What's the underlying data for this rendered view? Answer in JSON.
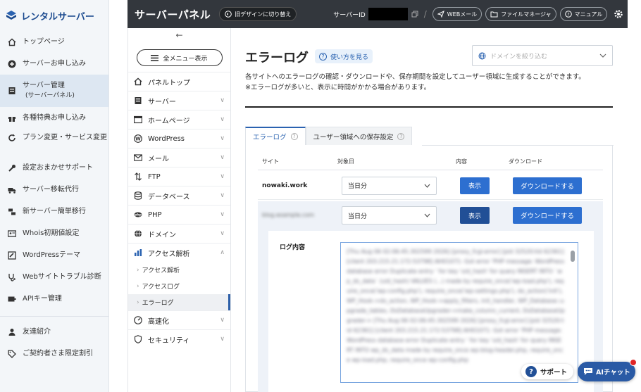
{
  "brand": {
    "name": "レンタルサーバー"
  },
  "account_menu": [
    {
      "label": "トップページ",
      "icon": "home-icon"
    },
    {
      "label": "サーバーお申し込み",
      "icon": "plus-circle-icon"
    },
    {
      "label": "サーバー管理",
      "sub": "(サーバーパネル)",
      "icon": "server-icon",
      "active": true
    },
    {
      "label": "各種特典お申し込み",
      "icon": "gift-icon"
    },
    {
      "label": "プラン変更・サービス変更",
      "icon": "refresh-icon"
    },
    {
      "label": "設定おまかせサポート",
      "icon": "wrench-icon"
    },
    {
      "label": "サーバー移転代行",
      "icon": "truck-icon"
    },
    {
      "label": "新サーバー簡単移行",
      "icon": "transfer-icon"
    },
    {
      "label": "Whois初期値設定",
      "icon": "id-card-icon"
    },
    {
      "label": "WordPressテーマ",
      "icon": "theme-icon"
    },
    {
      "label": "Webサイトトラブル診断",
      "icon": "stethoscope-icon"
    },
    {
      "label": "APIキー管理",
      "icon": "api-key-icon"
    },
    {
      "label": "友達紹介",
      "icon": "person-icon"
    },
    {
      "label": "ご契約者さま限定割引",
      "icon": "discount-icon"
    }
  ],
  "header": {
    "title": "サーバーパネル",
    "old_design": "旧デザインに切り替え",
    "server_id_label": "サーバーID",
    "webmail": "WEBメール",
    "file_manager": "ファイルマネージャ",
    "manual": "マニュアル"
  },
  "nav": {
    "all_menu": "全メニュー表示",
    "items": [
      {
        "label": "パネルトップ",
        "icon": "home-icon",
        "chevron": ""
      },
      {
        "label": "サーバー",
        "icon": "server-icon",
        "chevron": "∨"
      },
      {
        "label": "ホームページ",
        "icon": "browser-icon",
        "chevron": "∨"
      },
      {
        "label": "WordPress",
        "icon": "wordpress-icon",
        "chevron": "∨"
      },
      {
        "label": "メール",
        "icon": "mail-icon",
        "chevron": "∨"
      },
      {
        "label": "FTP",
        "icon": "ftp-icon",
        "chevron": "∨"
      },
      {
        "label": "データベース",
        "icon": "database-icon",
        "chevron": "∨"
      },
      {
        "label": "PHP",
        "icon": "php-icon",
        "chevron": "∨"
      },
      {
        "label": "ドメイン",
        "icon": "globe-icon",
        "chevron": "∨"
      },
      {
        "label": "アクセス解析",
        "icon": "bar-chart-icon",
        "chevron": "∧"
      }
    ],
    "sub_items": [
      {
        "label": "アクセス解析"
      },
      {
        "label": "アクセスログ"
      },
      {
        "label": "エラーログ",
        "active": true
      }
    ],
    "items_after": [
      {
        "label": "高速化",
        "icon": "rocket-icon",
        "chevron": "∨"
      },
      {
        "label": "セキュリティ",
        "icon": "shield-icon",
        "chevron": "∨"
      }
    ]
  },
  "main": {
    "title": "エラーログ",
    "help": "使い方を見る",
    "domain_placeholder": "ドメインを絞り込む",
    "desc1": "各サイトへのエラーログの確認・ダウンロードや、保存期間を設定してユーザー領域に生成することができます。",
    "desc2": "※エラーログが多いと、表示に時間がかかる場合があります。",
    "tabs": [
      "エラーログ",
      "ユーザー領域への保存設定"
    ],
    "columns": {
      "site": "サイト",
      "date": "対象日",
      "content": "内容",
      "download": "ダウンロード"
    },
    "rows": [
      {
        "site": "nowaki.work",
        "date": "当日分",
        "show": "表示",
        "download": "ダウンロードする"
      },
      {
        "site": "blog.example.com",
        "date": "当日分",
        "show": "表示",
        "download": "ダウンロードする"
      }
    ],
    "log_label": "ログ内容",
    "log_text": "[Thu Aug 06 02:06:45.302599 2026] [proxy_fcgi:error] [pid 32520:tid 62361] [client 203.215.21.172:53798] AH01071: Got error 'PHP message: WordPress database error Duplicate entry ' for key 'uid_hash' for query INSERT INTO `wp_ds_data` (uid_hash) VALUES (...) made by require_once('wp-load.php'), require_once('wp-config.php'), require_once('wp-settings.php'), do_action('init'), WP_Hook->do_action, WP_Hook->apply_filters, init_handler, WP_Database::upgrade_tables, DsDatabaseUpgrader->make_column_current, DsDatabaseUpgrader-> [Thu Aug 06 02:06:45.302599 2026] [proxy_fcgi:error] [pid 32520:tid 62361] [client 203.215.21.172:53798] AH01071: Got error 'PHP message: WordPress database error Duplicate entry ' for key 'uid_hash' for query INSERT INTO wp_ds_data made by require_once wp-blog-header.php, require_once wp-load.php, require_once wp-config.php"
  },
  "floating": {
    "support": "サポート",
    "ai_chat": "AIチャット"
  }
}
